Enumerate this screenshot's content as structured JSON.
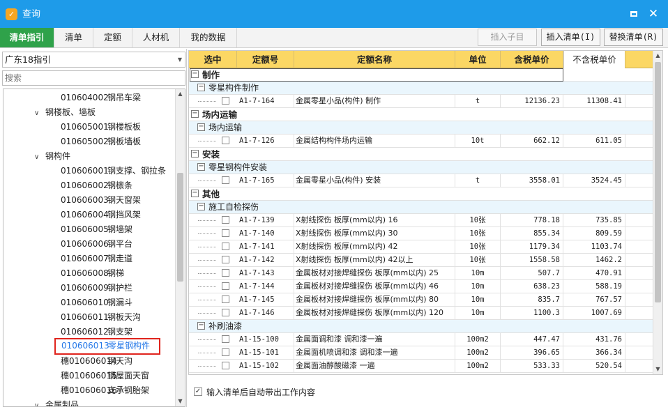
{
  "window": {
    "title": "查询",
    "app_icon": "app-logo-icon",
    "maximize_icon": "maximize-icon",
    "close_icon": "close-icon",
    "close_glyph": "✕"
  },
  "tabs": [
    "清单指引",
    "清单",
    "定额",
    "人材机",
    "我的数据"
  ],
  "toolbar": {
    "insert_child": "插入子目",
    "insert_list": "插入清单(I)",
    "replace_list": "替换清单(R)"
  },
  "left": {
    "combo_value": "广东18指引",
    "search_placeholder": "搜索",
    "tree": [
      {
        "code": "010604002",
        "name": "钢吊车梁",
        "level": 2
      },
      {
        "toggle": "∨",
        "name": "钢楼板、墙板",
        "level": 1
      },
      {
        "code": "010605001",
        "name": "钢楼板板",
        "level": 2
      },
      {
        "code": "010605002",
        "name": "钢板墙板",
        "level": 2
      },
      {
        "toggle": "∨",
        "name": "钢构件",
        "level": 1
      },
      {
        "code": "010606001",
        "name": "钢支撑、钢拉条",
        "level": 2
      },
      {
        "code": "010606002",
        "name": "钢檩条",
        "level": 2
      },
      {
        "code": "010606003",
        "name": "钢天窗架",
        "level": 2
      },
      {
        "code": "010606004",
        "name": "钢挡风架",
        "level": 2
      },
      {
        "code": "010606005",
        "name": "钢墙架",
        "level": 2
      },
      {
        "code": "010606006",
        "name": "钢平台",
        "level": 2
      },
      {
        "code": "010606007",
        "name": "钢走道",
        "level": 2
      },
      {
        "code": "010606008",
        "name": "钢梯",
        "level": 2
      },
      {
        "code": "010606009",
        "name": "钢护栏",
        "level": 2
      },
      {
        "code": "010606010",
        "name": "钢漏斗",
        "level": 2
      },
      {
        "code": "010606011",
        "name": "钢板天沟",
        "level": 2
      },
      {
        "code": "010606012",
        "name": "钢支架",
        "level": 2
      },
      {
        "code": "010606013",
        "name": "零星钢构件",
        "level": 2,
        "selected": true
      },
      {
        "code": "穗010606014",
        "name": "钢天沟",
        "level": 2
      },
      {
        "code": "穗010606015",
        "name": "钢屋面天窗",
        "level": 2
      },
      {
        "code": "穗010606016",
        "name": "支承钢胎架",
        "level": 2
      },
      {
        "toggle": "∨",
        "name": "金属制品",
        "level": 1
      }
    ]
  },
  "table": {
    "headers": [
      "选中",
      "定额号",
      "定额名称",
      "单位",
      "含税单价",
      "不含税单价"
    ],
    "rows": [
      {
        "type": "g1",
        "label": "制作"
      },
      {
        "type": "g2",
        "label": "零星构件制作"
      },
      {
        "type": "data",
        "code": "A1-7-164",
        "name": "金属零星小品(构件) 制作",
        "unit": "t",
        "tax": "12136.23",
        "notax": "11308.41"
      },
      {
        "type": "g1",
        "label": "场内运输"
      },
      {
        "type": "g2",
        "label": "场内运输"
      },
      {
        "type": "data",
        "code": "A1-7-126",
        "name": "金属结构构件场内运输",
        "unit": "10t",
        "tax": "662.12",
        "notax": "611.05"
      },
      {
        "type": "g1",
        "label": "安装"
      },
      {
        "type": "g2",
        "label": "零星钢构件安装"
      },
      {
        "type": "data",
        "code": "A1-7-165",
        "name": "金属零星小品(构件) 安装",
        "unit": "t",
        "tax": "3558.01",
        "notax": "3524.45"
      },
      {
        "type": "g1",
        "label": "其他"
      },
      {
        "type": "g2",
        "label": "施工自检探伤"
      },
      {
        "type": "data",
        "code": "A1-7-139",
        "name": "X射线探伤 板厚(mm以内) 16",
        "unit": "10张",
        "tax": "778.18",
        "notax": "735.85"
      },
      {
        "type": "data",
        "code": "A1-7-140",
        "name": "X射线探伤 板厚(mm以内) 30",
        "unit": "10张",
        "tax": "855.34",
        "notax": "809.59"
      },
      {
        "type": "data",
        "code": "A1-7-141",
        "name": "X射线探伤 板厚(mm以内) 42",
        "unit": "10张",
        "tax": "1179.34",
        "notax": "1103.74"
      },
      {
        "type": "data",
        "code": "A1-7-142",
        "name": "X射线探伤 板厚(mm以内) 42以上",
        "unit": "10张",
        "tax": "1558.58",
        "notax": "1462.2"
      },
      {
        "type": "data",
        "code": "A1-7-143",
        "name": "金属板材对接焊缝探伤 板厚(mm以内) 25",
        "unit": "10m",
        "tax": "507.7",
        "notax": "470.91"
      },
      {
        "type": "data",
        "code": "A1-7-144",
        "name": "金属板材对接焊缝探伤 板厚(mm以内) 46",
        "unit": "10m",
        "tax": "638.23",
        "notax": "588.19"
      },
      {
        "type": "data",
        "code": "A1-7-145",
        "name": "金属板材对接焊缝探伤 板厚(mm以内) 80",
        "unit": "10m",
        "tax": "835.7",
        "notax": "767.57"
      },
      {
        "type": "data",
        "code": "A1-7-146",
        "name": "金属板材对接焊缝探伤 板厚(mm以内) 120",
        "unit": "10m",
        "tax": "1100.3",
        "notax": "1007.69"
      },
      {
        "type": "g2",
        "label": "补刷油漆"
      },
      {
        "type": "data",
        "code": "A1-15-100",
        "name": "金属面调和漆 调和漆一遍",
        "unit": "100m2",
        "tax": "447.47",
        "notax": "431.76"
      },
      {
        "type": "data",
        "code": "A1-15-101",
        "name": "金属面机喷调和漆 调和漆一遍",
        "unit": "100m2",
        "tax": "396.65",
        "notax": "366.34"
      },
      {
        "type": "data",
        "code": "A1-15-102",
        "name": "金属面油醇酸磁漆 一遍",
        "unit": "100m2",
        "tax": "533.33",
        "notax": "520.54"
      }
    ]
  },
  "footer": {
    "auto_bring_label": "输入清单后自动带出工作内容",
    "checked": true,
    "check_glyph": "✓"
  }
}
